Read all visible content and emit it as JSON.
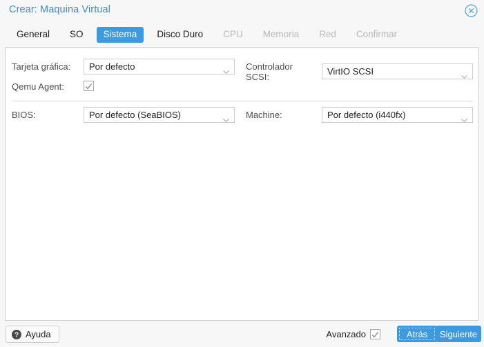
{
  "window": {
    "title": "Crear: Maquina Virtual",
    "close_icon": "close-circle-icon"
  },
  "tabs": [
    {
      "label": "General",
      "state": "enabled"
    },
    {
      "label": "SO",
      "state": "enabled"
    },
    {
      "label": "Sistema",
      "state": "active"
    },
    {
      "label": "Disco Duro",
      "state": "enabled"
    },
    {
      "label": "CPU",
      "state": "disabled"
    },
    {
      "label": "Memoria",
      "state": "disabled"
    },
    {
      "label": "Red",
      "state": "disabled"
    },
    {
      "label": "Confirmar",
      "state": "disabled"
    }
  ],
  "form": {
    "graphic_card": {
      "label": "Tarjeta gráfica:",
      "value": "Por defecto"
    },
    "qemu_agent": {
      "label": "Qemu Agent:",
      "checked": true
    },
    "scsi_controller": {
      "label_line1": "Controlador",
      "label_line2": "SCSI:",
      "value": "VirtIO SCSI"
    },
    "bios": {
      "label": "BIOS:",
      "value": "Por defecto (SeaBIOS)"
    },
    "machine": {
      "label": "Machine:",
      "value": "Por defecto (i440fx)"
    }
  },
  "footer": {
    "help_label": "Ayuda",
    "help_icon": "question-circle-icon",
    "advanced_label": "Avanzado",
    "advanced_checked": true,
    "back_label": "Atrás",
    "next_label": "Siguiente"
  },
  "colors": {
    "accent": "#3c9ae0",
    "title": "#3a8bd4",
    "panel_bg": "#ffffff",
    "window_bg": "#f7f7f7",
    "disabled_text": "#b9b9b9"
  }
}
